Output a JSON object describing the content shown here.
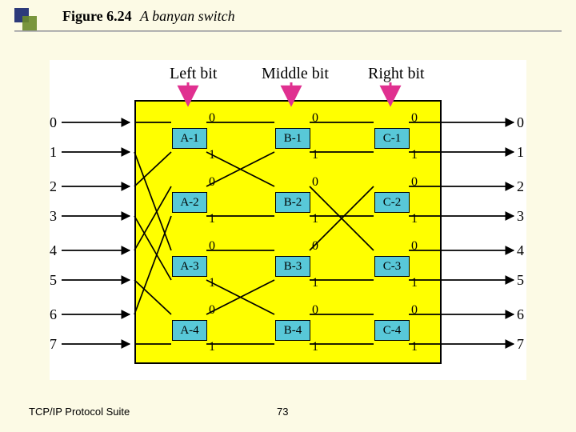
{
  "figure": {
    "label": "Figure 6.24",
    "title": "A banyan switch"
  },
  "footer": {
    "suite": "TCP/IP Protocol Suite",
    "page": "73"
  },
  "headings": {
    "left": "Left bit",
    "middle": "Middle bit",
    "right": "Right bit"
  },
  "ports": [
    "0",
    "1",
    "2",
    "3",
    "4",
    "5",
    "6",
    "7"
  ],
  "columns": {
    "A": [
      "A-1",
      "A-2",
      "A-3",
      "A-4"
    ],
    "B": [
      "B-1",
      "B-2",
      "B-3",
      "B-4"
    ],
    "C": [
      "C-1",
      "C-2",
      "C-3",
      "C-4"
    ]
  },
  "nodeOutputs": {
    "top": "0",
    "bottom": "1"
  }
}
